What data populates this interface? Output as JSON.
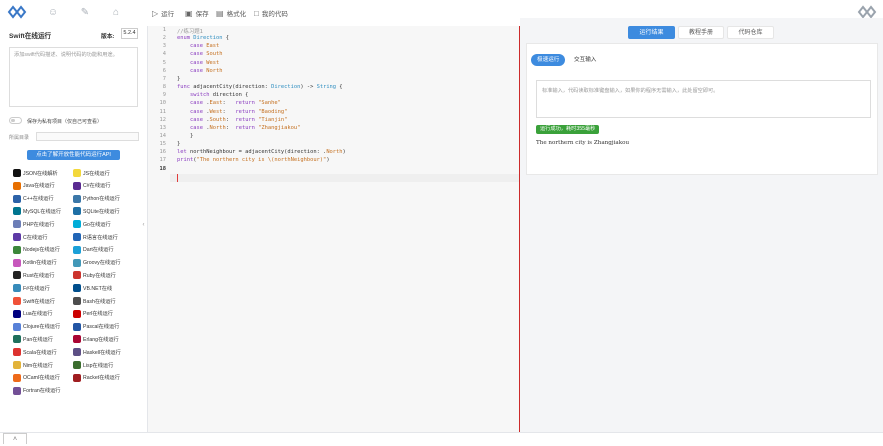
{
  "toolbar": {
    "run_label": "运行",
    "save_label": "保存",
    "format_label": "格式化",
    "mycode_label": "我的代码"
  },
  "left": {
    "title": "Swift在线运行",
    "version_label": "版本:",
    "version_value": "5.2.4",
    "desc_placeholder": "添加swift代码描述、说明代码的功能和用途。",
    "toggle_label": "保存为私有项目（仅自己可查看）",
    "path_label": "所属目录",
    "api_button": "点击了解开放性能代码运行API",
    "collapse_icon": "‹"
  },
  "languages": [
    {
      "label": "JSON在线解析",
      "color": "#111111"
    },
    {
      "label": "JS在线运行",
      "color": "#f3d83b"
    },
    {
      "label": "Java在线运行",
      "color": "#e76f00"
    },
    {
      "label": "C#在线运行",
      "color": "#5a2a91"
    },
    {
      "label": "C++在线运行",
      "color": "#2c62a8"
    },
    {
      "label": "Python在线运行",
      "color": "#3b77a8"
    },
    {
      "label": "MySQL在线运行",
      "color": "#00758f"
    },
    {
      "label": "SQLite在线运行",
      "color": "#1e6fa5"
    },
    {
      "label": "PHP在线运行",
      "color": "#6c7eb7"
    },
    {
      "label": "Go在线运行",
      "color": "#00add8"
    },
    {
      "label": "C在线运行",
      "color": "#5e3aa6"
    },
    {
      "label": "R语言在线运行",
      "color": "#2165b6"
    },
    {
      "label": "Nodejs在线运行",
      "color": "#3c873a"
    },
    {
      "label": "Dart在线运行",
      "color": "#1ba0d8"
    },
    {
      "label": "Kotlin在线运行",
      "color": "#c757bc"
    },
    {
      "label": "Groovy在线运行",
      "color": "#4298b8"
    },
    {
      "label": "Rust在线运行",
      "color": "#222222"
    },
    {
      "label": "Ruby在线运行",
      "color": "#cc342d"
    },
    {
      "label": "F#在线运行",
      "color": "#378bba"
    },
    {
      "label": "VB.NET在线",
      "color": "#004e8c"
    },
    {
      "label": "Swift在线运行",
      "color": "#f05138"
    },
    {
      "label": "Bash在线运行",
      "color": "#4d4d4d"
    },
    {
      "label": "Lua在线运行",
      "color": "#000080"
    },
    {
      "label": "Perl在线运行",
      "color": "#cc0000"
    },
    {
      "label": "Clojure在线运行",
      "color": "#5881d8"
    },
    {
      "label": "Pascal在线运行",
      "color": "#2255a4"
    },
    {
      "label": "Pan在线运行",
      "color": "#1f6f5c"
    },
    {
      "label": "Erlang在线运行",
      "color": "#a90533"
    },
    {
      "label": "Scala在线运行",
      "color": "#dc322f"
    },
    {
      "label": "Haskell在线运行",
      "color": "#5d4f85"
    },
    {
      "label": "Nim在线运行",
      "color": "#e2b33a"
    },
    {
      "label": "Lisp在线运行",
      "color": "#3b6d2e"
    },
    {
      "label": "OCaml在线运行",
      "color": "#ee6a1a"
    },
    {
      "label": "Racket在线运行",
      "color": "#9f1d20"
    },
    {
      "label": "Fortran在线运行",
      "color": "#734f96"
    }
  ],
  "editor": {
    "line_numbers": [
      "1",
      "2",
      "3",
      "4",
      "5",
      "6",
      "7",
      "8",
      "9",
      "10",
      "11",
      "12",
      "13",
      "14",
      "15",
      "16",
      "17",
      "18"
    ],
    "current_line": "18",
    "lines": [
      "//练习题1",
      "enum Direction {",
      "    case East",
      "    case South",
      "    case West",
      "    case North",
      "}",
      "func adjacentCity(direction: Direction) -> String {",
      "    switch direction {",
      "    case .East:   return \"Sanhe\"",
      "    case .West:   return \"Baoding\"",
      "    case .South:  return \"Tianjin\"",
      "    case .North:  return \"Zhangjiakou\"",
      "    }",
      "}",
      "let northNeighbour = adjacentCity(direction: .North)",
      "print(\"The northern city is \\(northNeighbour)\")",
      ""
    ]
  },
  "right": {
    "tabs": [
      "运行结果",
      "教程手册",
      "代码仓库"
    ],
    "subtabs": [
      "极速运行",
      "交互输入"
    ],
    "input_placeholder": "标准输入，代码读取标准键盘输入，如果你的程序无需输入，此处留空即可。",
    "status": "运行成功，耗时355毫秒",
    "output": "The northern city is Zhangjiakou"
  },
  "colors": {
    "accent": "#3d8bdf",
    "success": "#3aa13a",
    "divider": "#cc2b2b"
  }
}
